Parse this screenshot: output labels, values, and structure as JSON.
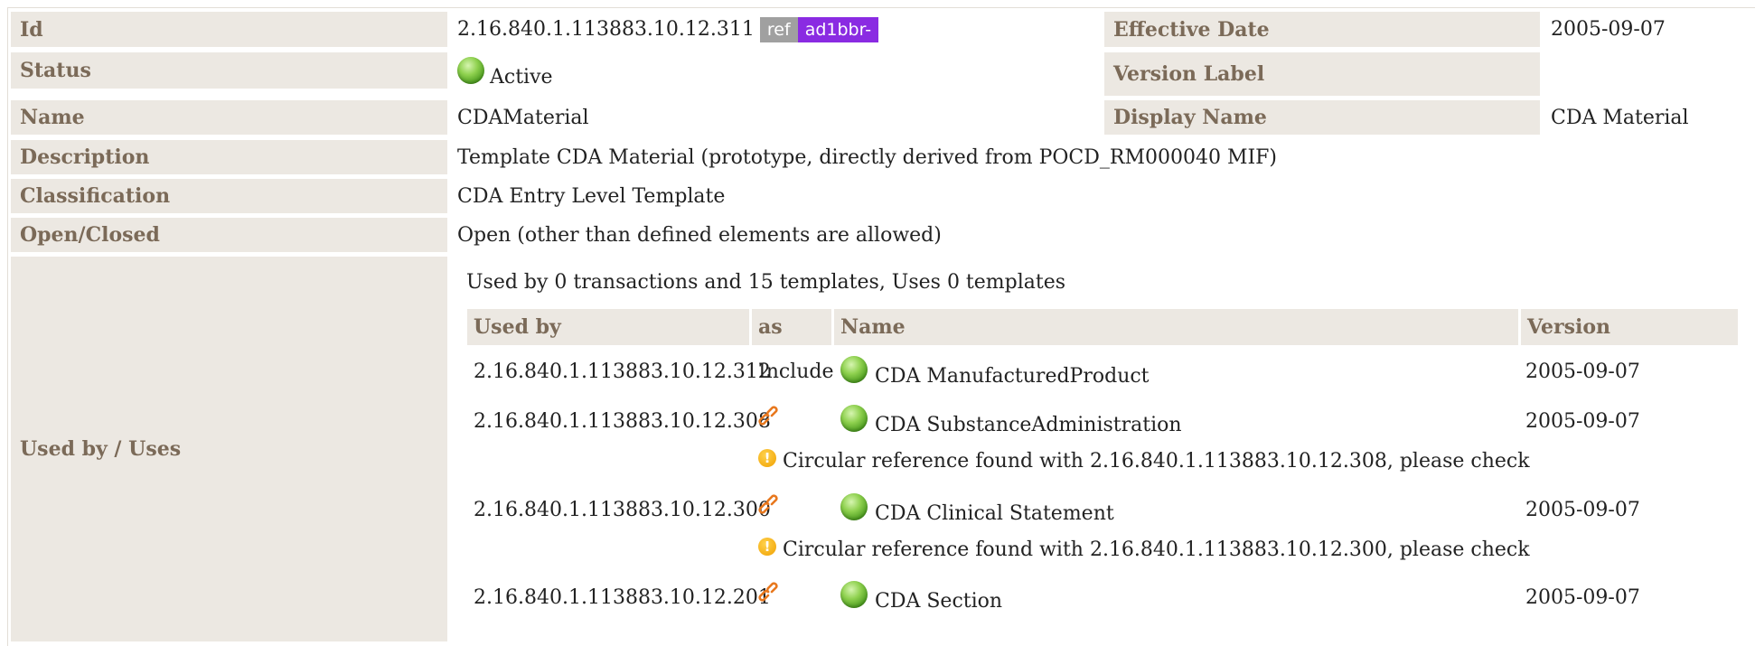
{
  "rows": {
    "id": {
      "label": "Id",
      "value": "2.16.840.1.113883.10.12.311",
      "badge_ref": "ref",
      "badge_project": "ad1bbr-"
    },
    "effective_date": {
      "label": "Effective Date",
      "value": "2005-09-07"
    },
    "status": {
      "label": "Status",
      "value": "Active",
      "icon": "active-status-icon"
    },
    "version_label": {
      "label": "Version Label",
      "value": ""
    },
    "name": {
      "label": "Name",
      "value": "CDAMaterial"
    },
    "display_name": {
      "label": "Display Name",
      "value": "CDA Material"
    },
    "description": {
      "label": "Description",
      "value": "Template CDA Material (prototype, directly derived from POCD_RM000040 MIF)"
    },
    "classification": {
      "label": "Classification",
      "value": "CDA Entry Level Template"
    },
    "open_closed": {
      "label": "Open/Closed",
      "value": "Open (other than defined elements are allowed)"
    },
    "used_by_uses": {
      "label": "Used by / Uses"
    }
  },
  "usage": {
    "summary": "Used by 0 transactions and 15 templates, Uses 0 templates",
    "headers": {
      "used_by": "Used by",
      "as": "as",
      "name": "Name",
      "version": "Version"
    },
    "items": [
      {
        "id": "2.16.840.1.113883.10.12.312",
        "as": "Include",
        "name": "CDA ManufacturedProduct",
        "version": "2005-09-07"
      },
      {
        "id": "2.16.840.1.113883.10.12.308",
        "as_icon": "link-icon",
        "name": "CDA SubstanceAdministration",
        "version": "2005-09-07",
        "warning": "Circular reference found with 2.16.840.1.113883.10.12.308, please check"
      },
      {
        "id": "2.16.840.1.113883.10.12.300",
        "as_icon": "link-icon",
        "name": "CDA Clinical Statement",
        "version": "2005-09-07",
        "warning": "Circular reference found with 2.16.840.1.113883.10.12.300, please check"
      },
      {
        "id": "2.16.840.1.113883.10.12.201",
        "as_icon": "link-icon",
        "name": "CDA Section",
        "version": "2005-09-07"
      }
    ]
  },
  "colors": {
    "label_bg": "#ece8e2",
    "label_text": "#7b6a58",
    "ref_badge": "#a0a0a0",
    "project_badge": "#8a2be2",
    "active": "#6cbf36",
    "link": "#e8781e",
    "warning": "#f0a000"
  }
}
